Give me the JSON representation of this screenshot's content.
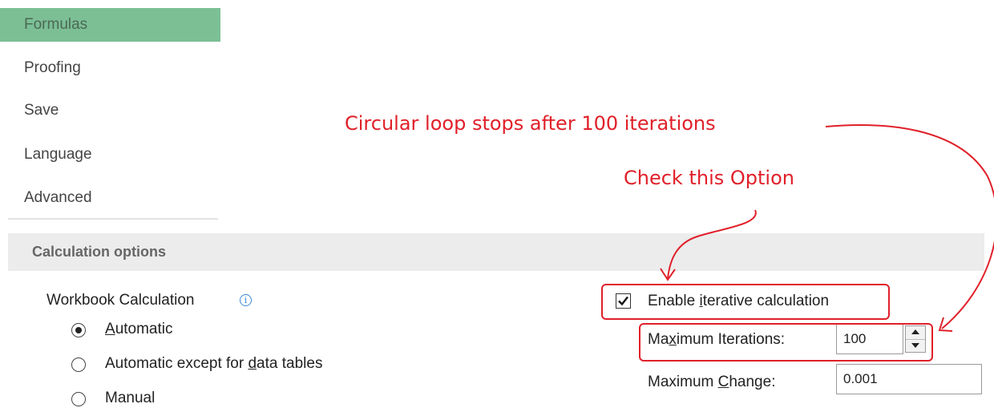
{
  "nav": {
    "items": [
      {
        "label": "Formulas",
        "selected": true
      },
      {
        "label": "Proofing",
        "selected": false
      },
      {
        "label": "Save",
        "selected": false
      },
      {
        "label": "Language",
        "selected": false
      },
      {
        "label": "Advanced",
        "selected": false
      }
    ]
  },
  "section": {
    "title": "Calculation options"
  },
  "workbook_calc": {
    "label": "Workbook Calculation",
    "info_icon": "info-icon",
    "options": [
      {
        "label": "Automatic",
        "access_key": "A",
        "checked": true
      },
      {
        "label": "Automatic except for data tables",
        "access_key": "d",
        "checked": false
      },
      {
        "label": "Manual",
        "access_key": "",
        "checked": false
      }
    ]
  },
  "iterative": {
    "enable_label": "Enable iterative calculation",
    "enable_checked": true,
    "max_iterations_label": "Maximum Iterations:",
    "max_iterations_value": "100",
    "max_change_label": "Maximum Change:",
    "max_change_value": "0.001"
  },
  "annotations": {
    "loop_note": "Circular loop stops after 100 iterations",
    "check_note": "Check this Option",
    "color": "#e0202a"
  },
  "colors": {
    "nav_selected": "#7cbf95",
    "section_bg": "#ececec"
  }
}
